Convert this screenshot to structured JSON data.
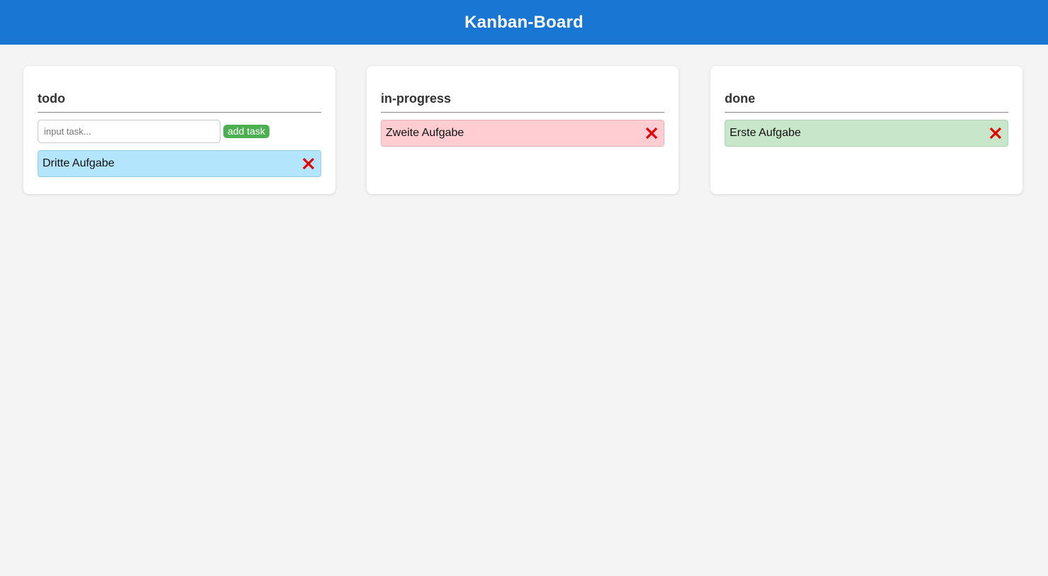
{
  "header": {
    "title": "Kanban-Board"
  },
  "columns": [
    {
      "title": "todo",
      "input_placeholder": "input task...",
      "add_label": "add task",
      "tasks": [
        {
          "text": "Dritte Aufgabe",
          "color": "#b3e5fc"
        }
      ]
    },
    {
      "title": "in-progress",
      "tasks": [
        {
          "text": "Zweite Aufgabe",
          "color": "#ffcdd2"
        }
      ]
    },
    {
      "title": "done",
      "tasks": [
        {
          "text": "Erste Aufgabe",
          "color": "#c8e6c9"
        }
      ]
    }
  ],
  "colors": {
    "header_bg": "#1976d2",
    "add_button": "#4caf50",
    "delete_icon": "#e60000"
  },
  "icons": {
    "delete": "close-icon"
  }
}
